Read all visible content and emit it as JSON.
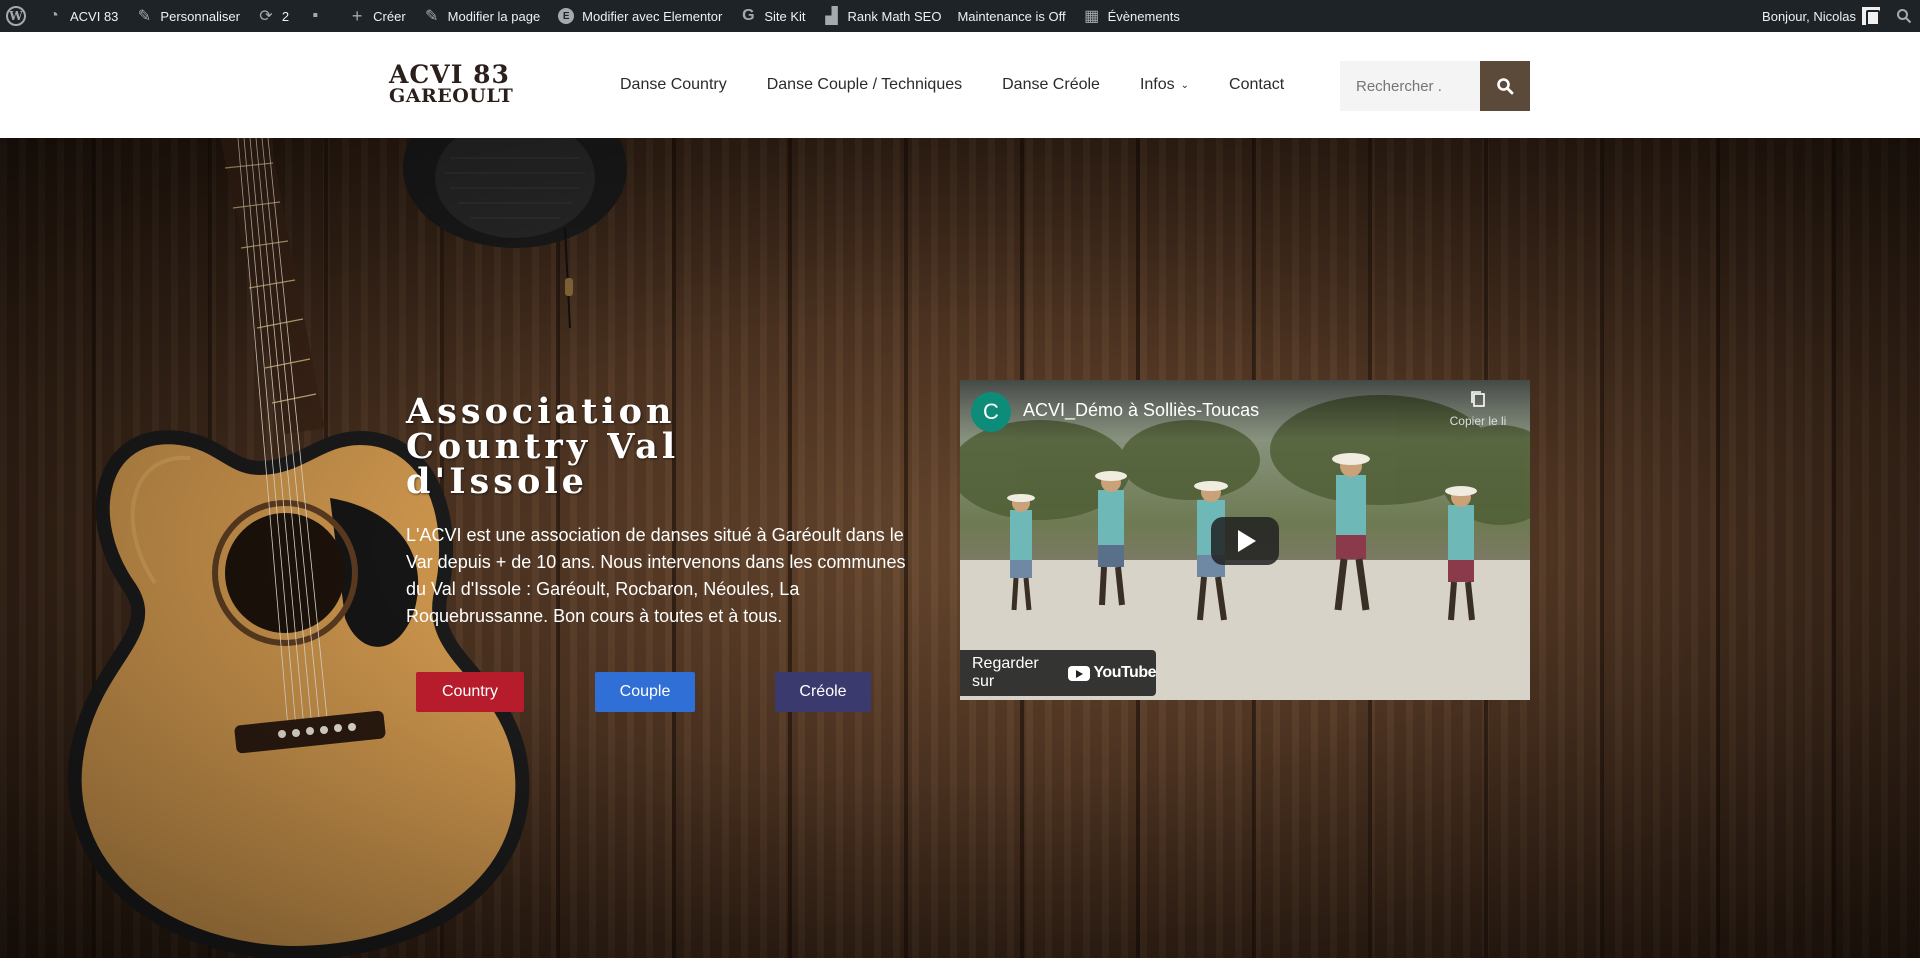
{
  "adminbar": {
    "site_name": "ACVI 83",
    "customize": "Personnaliser",
    "updates_count": "2",
    "create": "Créer",
    "edit_page": "Modifier la page",
    "edit_elementor": "Modifier avec Elementor",
    "site_kit": "Site Kit",
    "rank_math": "Rank Math SEO",
    "maintenance": "Maintenance is Off",
    "events": "Évènements",
    "greeting": "Bonjour, Nicolas"
  },
  "header": {
    "logo_line1": "ACVI 83",
    "logo_line2": "GAREOULT",
    "nav": [
      {
        "label": "Danse Country"
      },
      {
        "label": "Danse Couple / Techniques"
      },
      {
        "label": "Danse Créole"
      },
      {
        "label": "Infos"
      },
      {
        "label": "Contact"
      }
    ],
    "search_placeholder": "Rechercher ."
  },
  "hero": {
    "title": "Association Country Val d'Issole",
    "text": "L'ACVI est une association de danses situé à Garéoult dans le Var  depuis + de 10 ans. Nous intervenons dans les communes du Val d'Issole : Garéoult, Rocbaron, Néoules, La Roquebrussanne. Bon cours à toutes et à tous.",
    "buttons": [
      {
        "label": "Country",
        "color": "#b71c2c"
      },
      {
        "label": "Couple",
        "color": "#2f6fd6"
      },
      {
        "label": "Créole",
        "color": "#3a3a6e"
      }
    ]
  },
  "video": {
    "channel_initial": "C",
    "title": "ACVI_Démo à Solliès-Toucas",
    "copy_link": "Copier le li",
    "watch_on": "Regarder sur",
    "youtube": "YouTube"
  },
  "colors": {
    "adminbar_bg": "#1d2327",
    "search_button": "#5b4a3a",
    "channel_avatar": "#0d8c79"
  }
}
